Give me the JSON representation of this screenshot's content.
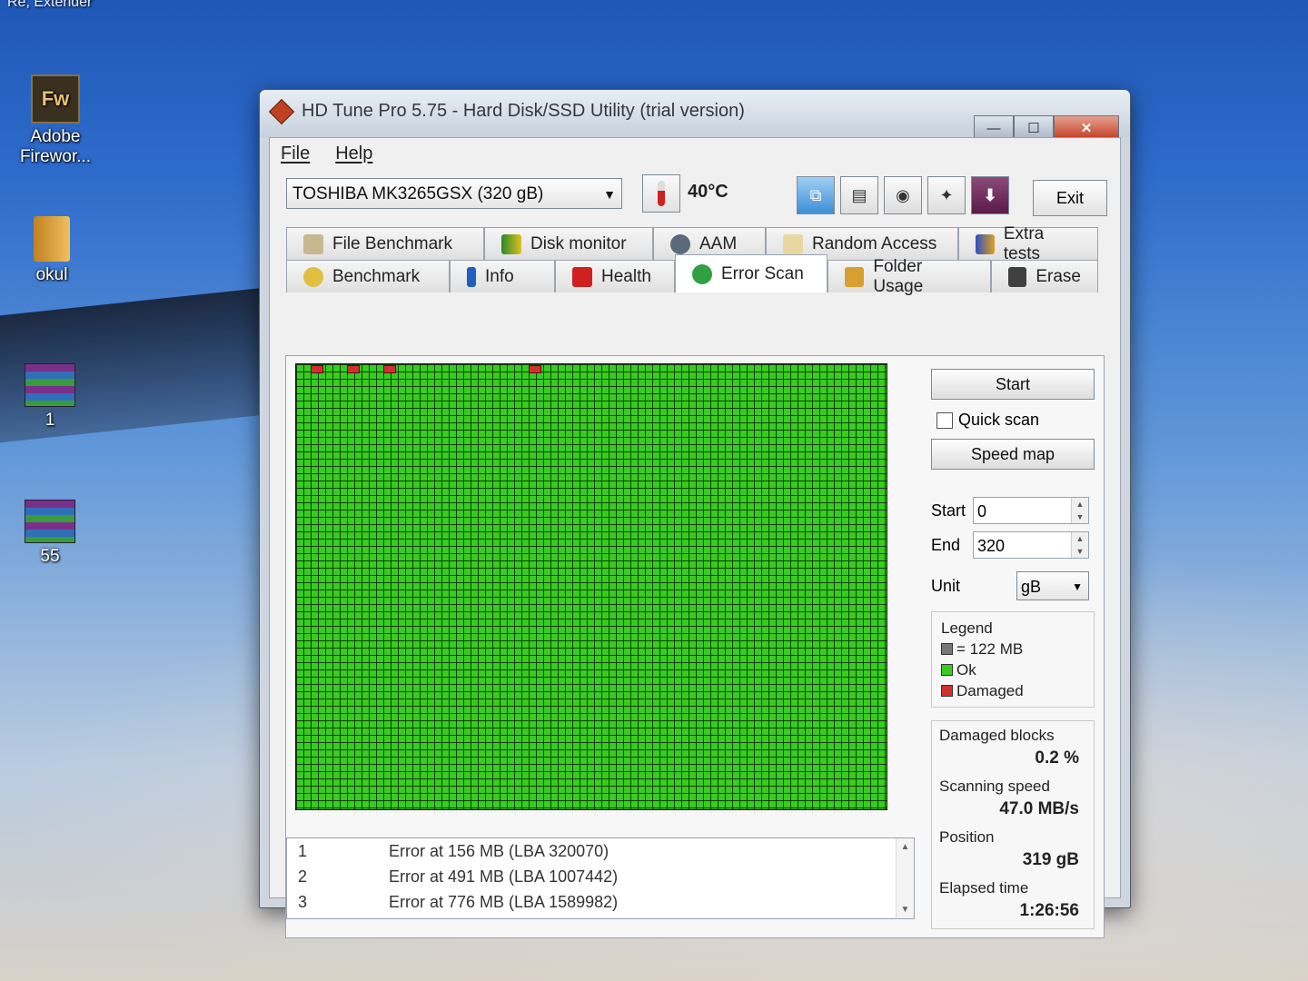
{
  "desktop": {
    "partial_label": "Re, Extender",
    "icons": [
      {
        "label": "Adobe Firewor..."
      },
      {
        "label": "okul"
      },
      {
        "label": "1"
      },
      {
        "label": "55"
      }
    ]
  },
  "window": {
    "title": "HD Tune Pro 5.75 - Hard Disk/SSD Utility (trial version)",
    "menu": {
      "file": "File",
      "help": "Help"
    },
    "drive": "TOSHIBA MK3265GSX (320 gB)",
    "temperature": "40°C",
    "exit_label": "Exit",
    "tabs_row1": [
      "File Benchmark",
      "Disk monitor",
      "AAM",
      "Random Access",
      "Extra tests"
    ],
    "tabs_row2": [
      "Benchmark",
      "Info",
      "Health",
      "Error Scan",
      "Folder Usage",
      "Erase"
    ],
    "selected_tab": "Error Scan"
  },
  "scan": {
    "start_button": "Start",
    "quick_scan_label": "Quick scan",
    "quick_scan_checked": false,
    "speed_map_button": "Speed map",
    "start_label": "Start",
    "start_value": "0",
    "end_label": "End",
    "end_value": "320",
    "unit_label": "Unit",
    "unit_value": "gB",
    "legend_title": "Legend",
    "legend_block": "= 122 MB",
    "legend_ok": "Ok",
    "legend_damaged": "Damaged",
    "damaged_blocks_label": "Damaged blocks",
    "damaged_blocks_value": "0.2 %",
    "scanning_speed_label": "Scanning speed",
    "scanning_speed_value": "47.0 MB/s",
    "position_label": "Position",
    "position_value": "319 gB",
    "elapsed_label": "Elapsed time",
    "elapsed_value": "1:26:56",
    "colors": {
      "ok": "#37cc1e",
      "damaged": "#d03030",
      "block": "#777777"
    },
    "errors": [
      {
        "n": "1",
        "text": "Error at 156 MB (LBA 320070)"
      },
      {
        "n": "2",
        "text": "Error at 491 MB (LBA 1007442)"
      },
      {
        "n": "3",
        "text": "Error at 776 MB (LBA 1589982)"
      }
    ]
  }
}
